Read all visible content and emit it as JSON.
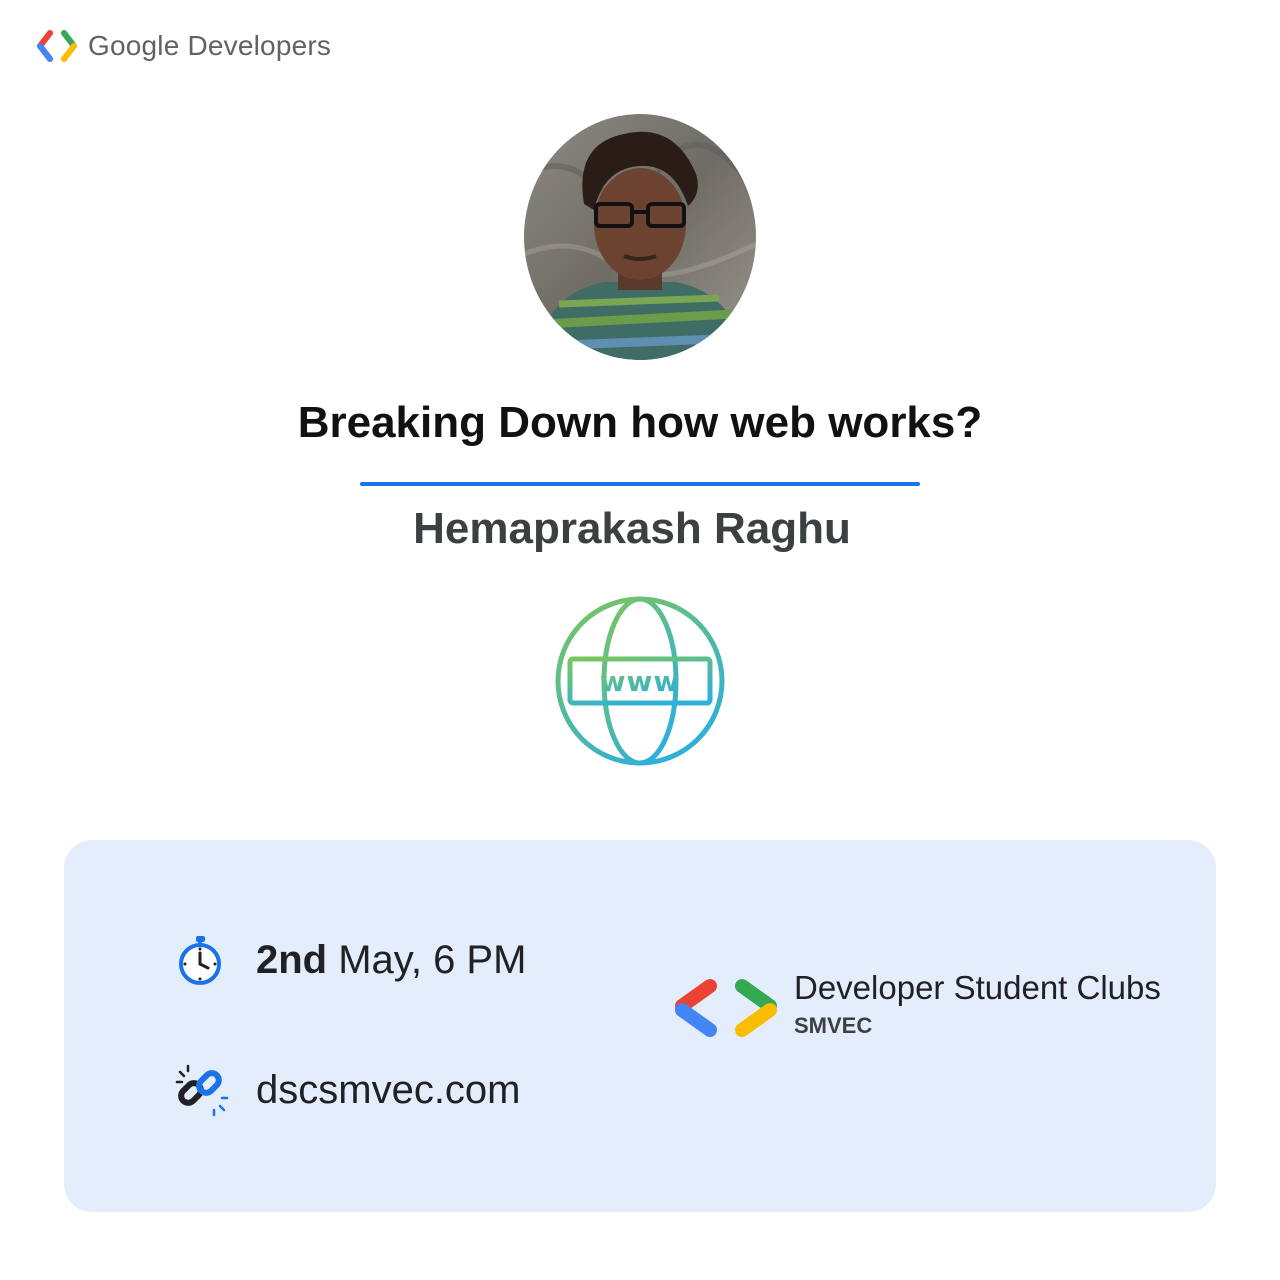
{
  "header": {
    "brand_text": "Google Developers",
    "logo_icon": "google-developers-logo"
  },
  "event": {
    "title": "Breaking Down how web works?",
    "speaker": "Hemaprakash Raghu",
    "topic_icon": "globe-www-icon",
    "date_strong": "2nd",
    "date_rest": " May, 6 PM",
    "link": "dscsmvec.com"
  },
  "club": {
    "name": "Developer Student Clubs",
    "chapter": "SMVEC",
    "logo_icon": "dsc-logo"
  },
  "colors": {
    "accent": "#1a73e8",
    "panel": "#e3edfc",
    "red": "#ea4335",
    "blue": "#4285f4",
    "green": "#34a853",
    "yellow": "#fbbc04"
  }
}
